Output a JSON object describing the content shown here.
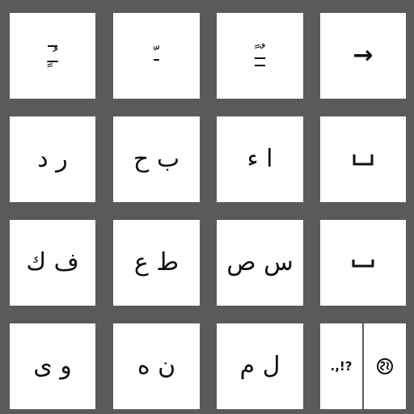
{
  "keyboard": {
    "row0": {
      "k0": "ـُـٍ",
      "k1": "ـّ",
      "k2": "ـٌـً",
      "k3": "→"
    },
    "row1": {
      "k0": "ر د",
      "k1": "ب ح",
      "k2": "ا ء",
      "k3": "↵"
    },
    "row2": {
      "k0": "ف ك",
      "k1": "ط ع",
      "k2": "س ص",
      "k3": "␣"
    },
    "row3": {
      "k0": "و ى",
      "k1": "ن ه",
      "k2": "ل م",
      "k3_punct": ".,!?",
      "k3_globe_icon": "globe-icon"
    }
  },
  "colors": {
    "background": "#5a5a5a",
    "key": "#ffffff",
    "text": "#111111"
  }
}
